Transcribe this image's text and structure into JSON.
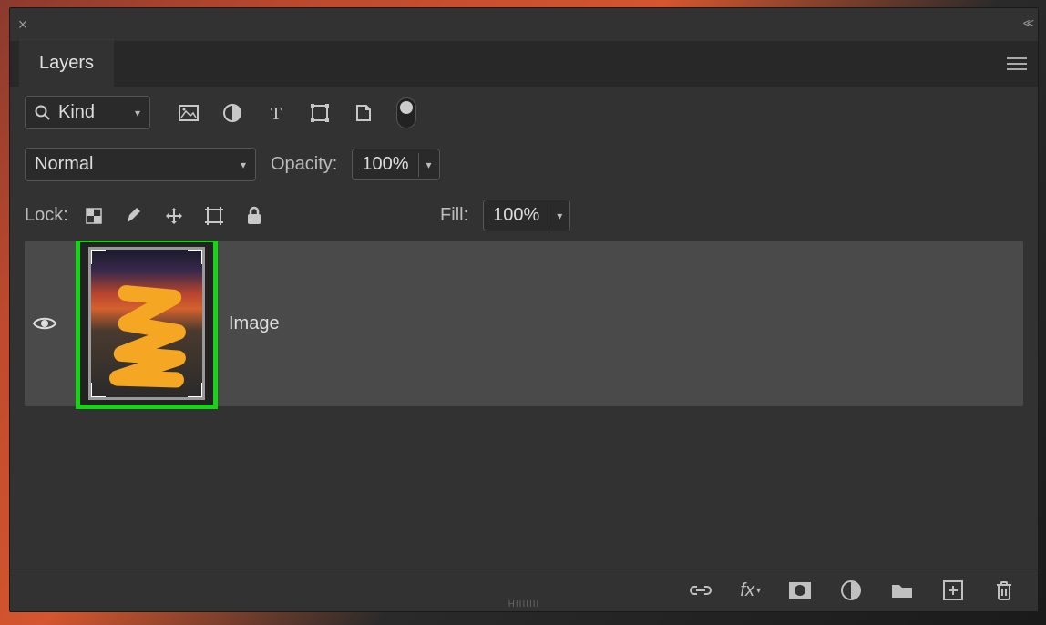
{
  "panel": {
    "title": "Layers"
  },
  "filter": {
    "label": "Kind"
  },
  "blend": {
    "mode": "Normal",
    "opacity_label": "Opacity:",
    "opacity_value": "100%"
  },
  "lock": {
    "label": "Lock:",
    "fill_label": "Fill:",
    "fill_value": "100%"
  },
  "layers": [
    {
      "name": "Image",
      "visible": true
    }
  ],
  "bottom_icons": [
    "link",
    "fx",
    "mask",
    "adjustment",
    "group",
    "new",
    "delete"
  ]
}
